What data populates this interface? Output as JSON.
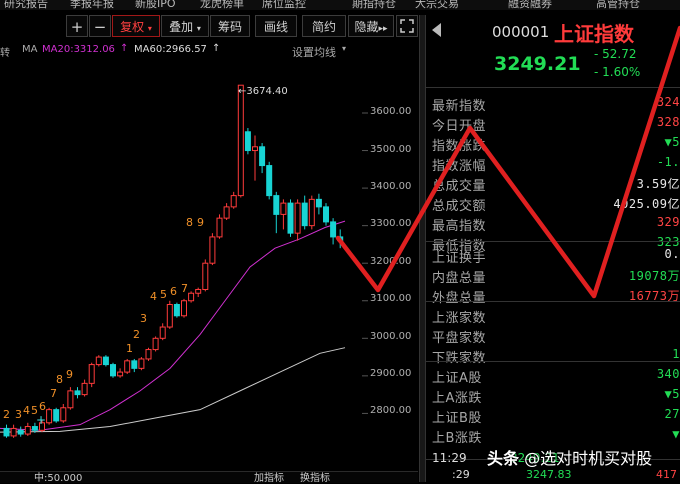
{
  "top_menu": [
    "研究报告",
    "季报年报",
    "新股IPO",
    "龙虎榜单",
    "席位监控",
    "期指持仓",
    "大宗交易",
    "融资融券",
    "高管持仓"
  ],
  "toolbar": {
    "plus": "+",
    "minus": "−",
    "fuquan": "复权",
    "diejia": "叠加",
    "chouma": "筹码",
    "huaxian": "画线",
    "jianyue": "简约",
    "yincang": "隐藏"
  },
  "ma": {
    "prefix": "MA",
    "ma20": "MA20:3312.06",
    "ma60": "MA60:2966.57",
    "setting": "设置均线"
  },
  "left_label": "转",
  "price_axis": [
    "3600.00",
    "3500.00",
    "3400.00",
    "3300.00",
    "3200.00",
    "3100.00",
    "3000.00",
    "2900.00",
    "2800.00"
  ],
  "high_label": "3674.40",
  "bottom": {
    "left": "中:50.000",
    "a": "加指标",
    "b": "换指标"
  },
  "quote": {
    "code": "000001",
    "name": "上证指数",
    "price": "3249.21",
    "change": "- 52.72",
    "pct": "- 1.60%"
  },
  "stats": [
    {
      "label": "最新指数",
      "value": "324",
      "color": "#ff4444"
    },
    {
      "label": "今日开盘",
      "value": "328",
      "color": "#ff4444"
    },
    {
      "label": "指数涨跌",
      "value": "▼5",
      "color": "#22dd55"
    },
    {
      "label": "指数涨幅",
      "value": "-1.",
      "color": "#22dd55"
    },
    {
      "label": "总成交量",
      "value": "3.59亿",
      "color": "#e8e8e8"
    },
    {
      "label": "总成交额",
      "value": "4025.09亿",
      "color": "#e8e8e8"
    },
    {
      "label": "最高指数",
      "value": "329",
      "color": "#ff4444"
    },
    {
      "label": "最低指数",
      "value": "323",
      "color": "#22dd55"
    }
  ],
  "stats2": [
    {
      "label": "上证换手",
      "value": "0.",
      "color": "#e8e8e8"
    },
    {
      "label": "内盘总量",
      "value": "19078万",
      "color": "#22dd55"
    },
    {
      "label": "外盘总量",
      "value": "16773万",
      "color": "#ff4444"
    }
  ],
  "stats3": [
    {
      "label": "上涨家数",
      "value": "",
      "color": "#ff4444"
    },
    {
      "label": "平盘家数",
      "value": "",
      "color": "#e8e8e8"
    },
    {
      "label": "下跌家数",
      "value": "1",
      "color": "#22dd55"
    }
  ],
  "stats4": [
    {
      "label": "上证A股",
      "value": "340",
      "color": "#22dd55"
    },
    {
      "label": "上A涨跌",
      "value": "▼5",
      "color": "#22dd55"
    },
    {
      "label": "上证B股",
      "value": "27",
      "color": "#22dd55"
    },
    {
      "label": "上B涨跌",
      "value": "▼",
      "color": "#22dd55"
    }
  ],
  "ticker": {
    "time": "11:29",
    "val": "3249.21",
    "time2": ":29",
    "val2": "3247.83",
    "val2b": "417"
  },
  "watermark": {
    "logo": "头条",
    "text": "@选对时机买对股"
  },
  "wave_numbers": [
    "2",
    "3",
    "4",
    "5",
    "6",
    "7",
    "8",
    "9",
    "1",
    "2",
    "3",
    "4",
    "5",
    "6",
    "7",
    "8",
    "9"
  ],
  "colors": {
    "up": "#ff3b3b",
    "down": "#18d4d4",
    "ma20": "#d030d0",
    "ma60": "#cccccc",
    "annotation": "#e02020",
    "number": "#f09028"
  }
}
